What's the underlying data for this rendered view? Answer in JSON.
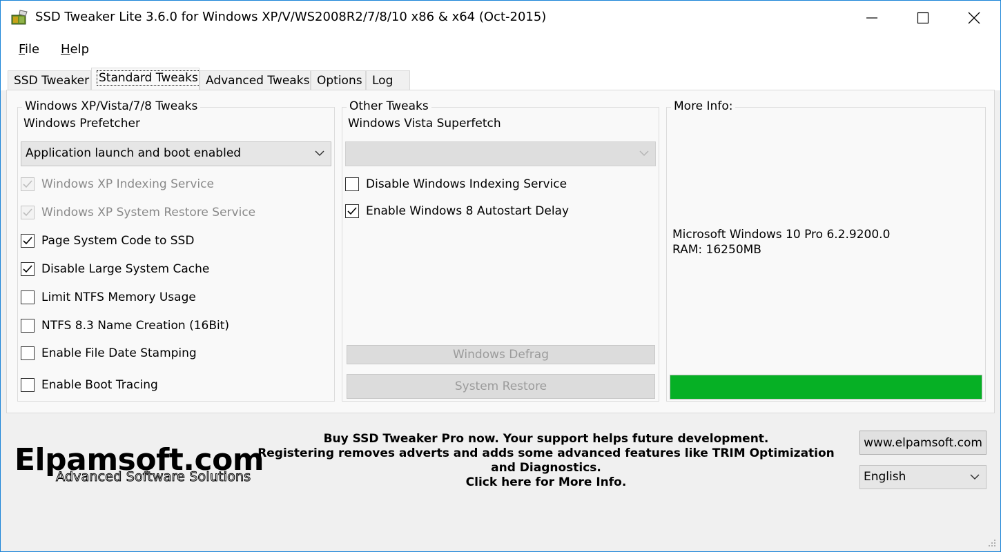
{
  "window": {
    "title": "SSD Tweaker Lite 3.6.0 for Windows XP/V/WS2008R2/7/8/10 x86 & x64 (Oct-2015)",
    "icons": {
      "app": "ssd-app-icon",
      "minimize": "minimize-icon",
      "maximize": "maximize-icon",
      "close": "close-icon"
    }
  },
  "menu": {
    "file": {
      "hotkey": "F",
      "rest": "ile"
    },
    "help": {
      "hotkey": "H",
      "rest": "elp"
    }
  },
  "tabs": [
    {
      "label": "SSD Tweaker",
      "active": false
    },
    {
      "label": "Standard Tweaks",
      "active": true
    },
    {
      "label": "Advanced Tweaks",
      "active": false
    },
    {
      "label": "Options",
      "active": false
    },
    {
      "label": "Log",
      "active": false
    }
  ],
  "left_group": {
    "title": "Windows XP/Vista/7/8 Tweaks",
    "prefetcher_label": "Windows Prefetcher",
    "prefetcher_value": "Application launch and boot enabled",
    "checks": [
      {
        "label": "Windows XP Indexing Service",
        "checked": true,
        "disabled": true
      },
      {
        "label": "Windows XP System Restore Service",
        "checked": true,
        "disabled": true
      },
      {
        "label": "Page System Code to SSD",
        "checked": true,
        "disabled": false
      },
      {
        "label": "Disable Large System Cache",
        "checked": true,
        "disabled": false
      },
      {
        "label": "Limit NTFS Memory Usage",
        "checked": false,
        "disabled": false
      },
      {
        "label": "NTFS 8.3 Name Creation (16Bit)",
        "checked": false,
        "disabled": false
      },
      {
        "label": "Enable File Date Stamping",
        "checked": false,
        "disabled": false
      },
      {
        "label": "Enable Boot Tracing",
        "checked": false,
        "disabled": false
      }
    ]
  },
  "middle_group": {
    "title": "Other Tweaks",
    "superfetch_label": "Windows Vista Superfetch",
    "superfetch_value": "",
    "checks": [
      {
        "label": "Disable Windows Indexing Service",
        "checked": false
      },
      {
        "label": "Enable Windows 8 Autostart Delay",
        "checked": true
      }
    ],
    "defrag_button": "Windows Defrag",
    "restore_button": "System Restore"
  },
  "right_group": {
    "title": "More Info:",
    "os_line": "Microsoft Windows 10 Pro 6.2.9200.0",
    "ram_line": "RAM: 16250MB",
    "progress_fraction": 1.0,
    "progress_color": "#06b025"
  },
  "footer": {
    "logo_main": "Elpamsoft.com",
    "logo_sub": "Advanced Software Solutions",
    "promo_line1": "Buy SSD Tweaker Pro now. Your support helps future development.",
    "promo_line2": "Registering removes adverts and adds some advanced features like TRIM Optimization and Diagnostics.",
    "promo_line3": "Click here for More Info.",
    "site_button": "www.elpamsoft.com",
    "language": "English"
  }
}
